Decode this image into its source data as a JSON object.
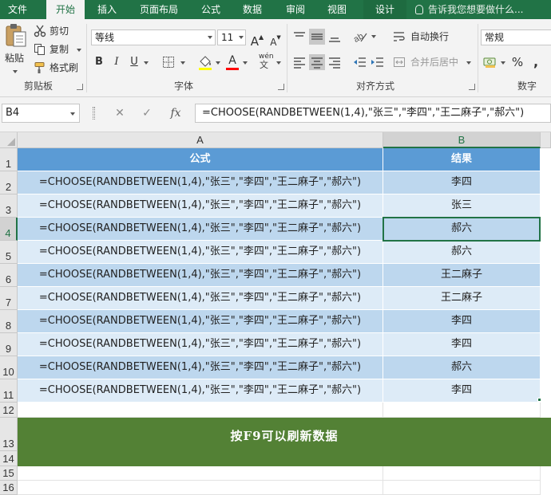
{
  "menu": {
    "tabs": [
      "文件",
      "开始",
      "插入",
      "页面布局",
      "公式",
      "数据",
      "审阅",
      "视图",
      "设计"
    ],
    "active": "开始",
    "tell_me": "告诉我您想要做什么..."
  },
  "ribbon": {
    "clipboard": {
      "paste": "粘贴",
      "cut": "剪切",
      "copy": "复制",
      "format_painter": "格式刷",
      "label": "剪贴板"
    },
    "font": {
      "font_name": "等线",
      "font_size": "11",
      "grow": "A",
      "shrink": "A",
      "bold": "B",
      "italic": "I",
      "underline": "U",
      "font_color_glyph": "A",
      "phonetic_glyph": "wén",
      "label": "字体"
    },
    "alignment": {
      "wrap_text": "自动换行",
      "merge_center": "合并后居中",
      "label": "对齐方式"
    },
    "number": {
      "format": "常规",
      "percent": "%",
      "comma": ",",
      "label": "数字"
    }
  },
  "formula_bar": {
    "name_box": "B4",
    "cancel": "✕",
    "enter": "✓",
    "fx": "fx",
    "formula": "=CHOOSE(RANDBETWEEN(1,4),\"张三\",\"李四\",\"王二麻子\",\"郝六\")"
  },
  "grid": {
    "columns": [
      "A",
      "B"
    ],
    "rows": [
      "1",
      "2",
      "3",
      "4",
      "5",
      "6",
      "7",
      "8",
      "9",
      "10",
      "11",
      "12",
      "13",
      "14",
      "15",
      "16"
    ],
    "selected_cell": "B4",
    "header": [
      "公式",
      "结果"
    ],
    "data": [
      {
        "formula": "=CHOOSE(RANDBETWEEN(1,4),\"张三\",\"李四\",\"王二麻子\",\"郝六\")",
        "result": "李四"
      },
      {
        "formula": "=CHOOSE(RANDBETWEEN(1,4),\"张三\",\"李四\",\"王二麻子\",\"郝六\")",
        "result": "张三"
      },
      {
        "formula": "=CHOOSE(RANDBETWEEN(1,4),\"张三\",\"李四\",\"王二麻子\",\"郝六\")",
        "result": "郝六"
      },
      {
        "formula": "=CHOOSE(RANDBETWEEN(1,4),\"张三\",\"李四\",\"王二麻子\",\"郝六\")",
        "result": "郝六"
      },
      {
        "formula": "=CHOOSE(RANDBETWEEN(1,4),\"张三\",\"李四\",\"王二麻子\",\"郝六\")",
        "result": "王二麻子"
      },
      {
        "formula": "=CHOOSE(RANDBETWEEN(1,4),\"张三\",\"李四\",\"王二麻子\",\"郝六\")",
        "result": "王二麻子"
      },
      {
        "formula": "=CHOOSE(RANDBETWEEN(1,4),\"张三\",\"李四\",\"王二麻子\",\"郝六\")",
        "result": "李四"
      },
      {
        "formula": "=CHOOSE(RANDBETWEEN(1,4),\"张三\",\"李四\",\"王二麻子\",\"郝六\")",
        "result": "李四"
      },
      {
        "formula": "=CHOOSE(RANDBETWEEN(1,4),\"张三\",\"李四\",\"王二麻子\",\"郝六\")",
        "result": "郝六"
      },
      {
        "formula": "=CHOOSE(RANDBETWEEN(1,4),\"张三\",\"李四\",\"王二麻子\",\"郝六\")",
        "result": "李四"
      }
    ],
    "banner": "按F9可以刷新数据"
  },
  "colors": {
    "excel_green": "#217346",
    "table_header": "#5b9bd5",
    "band_dark": "#bdd7ee",
    "band_light": "#ddebf7",
    "banner": "#538135"
  }
}
